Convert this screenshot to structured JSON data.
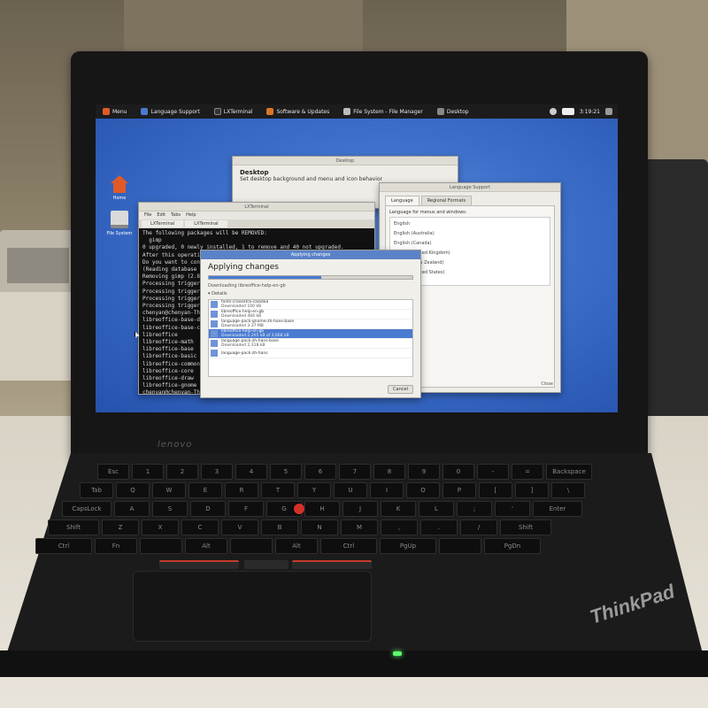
{
  "laptop": {
    "brand": "lenovo",
    "logo": "ThinkPad"
  },
  "panel": {
    "menu": "Menu",
    "tasks": [
      "Language Support",
      "LXTerminal",
      "Software & Updates",
      "File System - File Manager",
      "Desktop"
    ],
    "clock": "3:19:21"
  },
  "desktop_icons": [
    {
      "label": "Home"
    },
    {
      "label": "File System"
    }
  ],
  "windows": {
    "desktop": {
      "title": "Desktop",
      "heading": "Desktop",
      "subtitle": "Set desktop background and menu and icon behavior"
    },
    "language": {
      "title": "Language Support",
      "tabs": [
        "Language",
        "Regional Formats"
      ],
      "list_header": "Language for menus and windows:",
      "items": [
        "English",
        "English (Australia)",
        "English (Canada)",
        "English (United Kingdom)",
        "English (New Zealand)",
        "English (United States)"
      ],
      "close": "Close"
    },
    "terminal": {
      "title": "LXTerminal",
      "menu": [
        "File",
        "Edit",
        "Tabs",
        "Help"
      ],
      "tabs": [
        "LXTerminal",
        "LXTerminal"
      ],
      "lines": [
        "The following packages will be REMOVED:",
        "  gimp",
        "0 upgraded, 0 newly installed, 1 to remove and 40 not upgraded.",
        "After this operation, 15.0 MB disk space will be freed.",
        "Do you want to continue? [Y/n] y",
        "(Reading database ... ",
        "Removing gimp (2.8...",
        "Processing triggers",
        "Processing triggers",
        "Processing triggers",
        "Processing triggers",
        "chenyan@chenyan-Thi",
        "libreoffice-base-dr",
        "libreoffice-base-co",
        "libreoffice",
        "libreoffice-math",
        "libreoffice-base",
        "libreoffice-basic",
        "libreoffice-common",
        "libreoffice-core",
        "libreoffice-draw",
        "libreoffice-gnome",
        "chenyan@chenyan-Thi"
      ]
    },
    "apply": {
      "title": "Applying changes",
      "heading": "Applying changes",
      "progress": 0.55,
      "status": "Downloading libreoffice-help-en-gb",
      "details": "Details",
      "rows": [
        {
          "name": "fonts-crosextra-caladea",
          "sub": "Downloaded 100 kB",
          "selected": false
        },
        {
          "name": "libreoffice-help-en-gb",
          "sub": "Downloaded 484 kB",
          "selected": false
        },
        {
          "name": "language-pack-gnome-zh-hans-base",
          "sub": "Downloaded 3.37 MB",
          "selected": false
        },
        {
          "name": "libreoffice-help-en-gb",
          "sub": "Downloaded 2,205 kB of 3,668 kB",
          "selected": true
        },
        {
          "name": "language-pack-zh-hans-base",
          "sub": "Downloaded 2,318 kB",
          "selected": false
        },
        {
          "name": "language-pack-zh-hans",
          "sub": "",
          "selected": false
        }
      ],
      "cancel": "Cancel"
    }
  },
  "keyboard": {
    "row1": [
      "Esc",
      "1",
      "2",
      "3",
      "4",
      "5",
      "6",
      "7",
      "8",
      "9",
      "0",
      "-",
      "=",
      "Backspace"
    ],
    "row2": [
      "Tab",
      "Q",
      "W",
      "E",
      "R",
      "T",
      "Y",
      "U",
      "I",
      "O",
      "P",
      "[",
      "]",
      "\\"
    ],
    "row3": [
      "CapsLock",
      "A",
      "S",
      "D",
      "F",
      "G",
      "H",
      "J",
      "K",
      "L",
      ";",
      "'",
      "Enter"
    ],
    "row4": [
      "Shift",
      "Z",
      "X",
      "C",
      "V",
      "B",
      "N",
      "M",
      ",",
      ".",
      "/",
      "Shift"
    ],
    "row5": [
      "Ctrl",
      "Fn",
      "",
      "Alt",
      "",
      "Alt",
      "Ctrl",
      "PgUp",
      "",
      "PgDn"
    ]
  },
  "colors": {
    "accent": "#4a7bd0",
    "trackpoint": "#d3312a",
    "led": "#5cff6a"
  }
}
